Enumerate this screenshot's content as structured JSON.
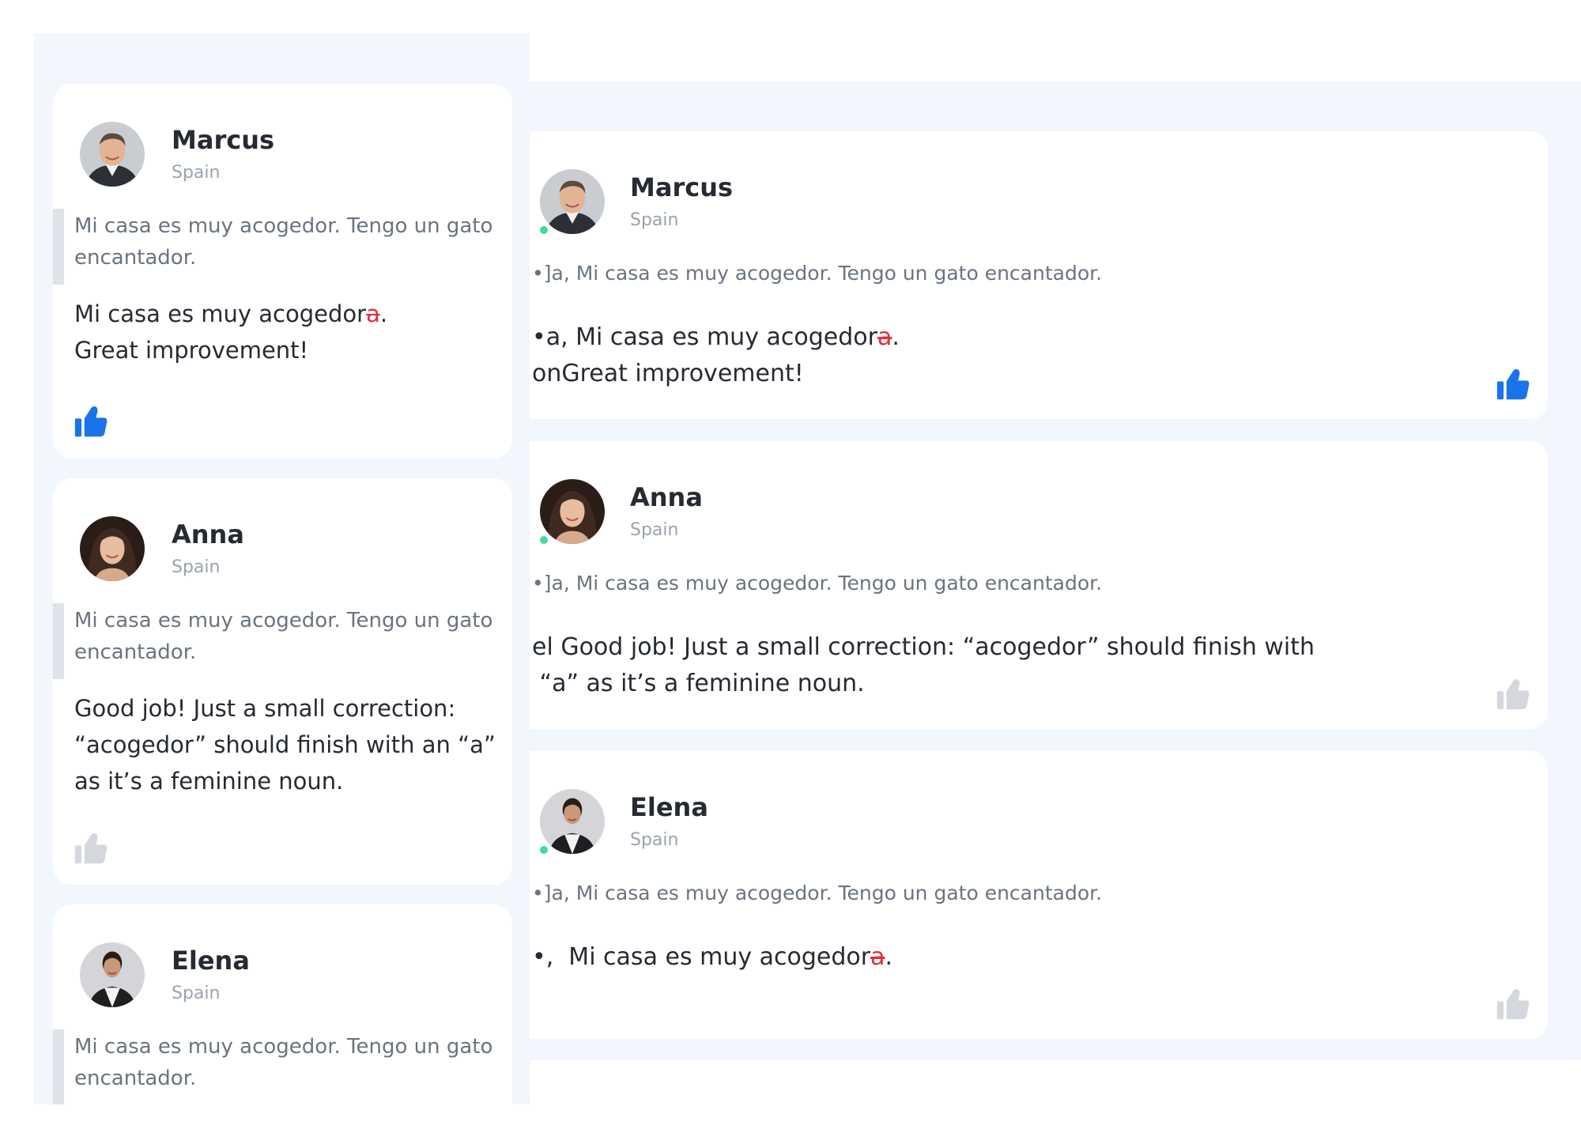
{
  "colors": {
    "panel_bg": "#f2f6fd",
    "card_bg": "#ffffff",
    "name": "#262a33",
    "muted": "#9aa3ae",
    "quote": "#6a7480",
    "correction_strike": "#e0303a",
    "like_active": "#1a73e8",
    "like_inactive": "#d4d8de",
    "online_dot": "#3fdc9c"
  },
  "wide_view": {
    "comments": [
      {
        "name": "Marcus",
        "country": "Spain",
        "quote": "•]a, Mi casa es muy acogedor. Tengo un gato encantador.",
        "reply_line1_prefix": "•a, Mi casa es muy acogedor",
        "reply_line1_struck": "a",
        "reply_line1_suffix": ".",
        "reply_line2": "onGreat improvement!",
        "liked": true,
        "avatar_icon": "avatar-marcus-icon",
        "like_icon": "thumbs-up-icon"
      },
      {
        "name": "Anna",
        "country": "Spain",
        "quote": "•]a, Mi casa es muy acogedor. Tengo un gato encantador.",
        "reply_line1": "el Good job! Just a small correction: “acogedor” should finish with",
        "reply_line2": " “a” as it’s a feminine noun.",
        "liked": false,
        "avatar_icon": "avatar-anna-icon",
        "like_icon": "thumbs-up-icon"
      },
      {
        "name": "Elena",
        "country": "Spain",
        "quote": "•]a, Mi casa es muy acogedor. Tengo un gato encantador.",
        "reply_line1_prefix": "•,  Mi casa es muy acogedor",
        "reply_line1_struck": "a",
        "reply_line1_suffix": ".",
        "liked": false,
        "avatar_icon": "avatar-elena-icon",
        "like_icon": "thumbs-up-icon"
      }
    ]
  },
  "narrow_view": {
    "comments": [
      {
        "name": "Marcus",
        "country": "Spain",
        "quote": "Mi casa es muy acogedor. Tengo un gato encantador.",
        "reply_line1_prefix": "Mi casa es muy acogedor",
        "reply_line1_struck": "a",
        "reply_line1_suffix": ".",
        "reply_line2": "Great improvement!",
        "liked": true,
        "avatar_icon": "avatar-marcus-icon",
        "like_icon": "thumbs-up-icon"
      },
      {
        "name": "Anna",
        "country": "Spain",
        "quote": "Mi casa es muy acogedor. Tengo un gato encantador.",
        "reply": "Good job! Just a small correction: “acogedor” should finish with an “a” as it’s a feminine noun.",
        "liked": false,
        "avatar_icon": "avatar-anna-icon",
        "like_icon": "thumbs-up-icon"
      },
      {
        "name": "Elena",
        "country": "Spain",
        "quote": "Mi casa es muy acogedor. Tengo un gato encantador.",
        "avatar_icon": "avatar-elena-icon"
      }
    ]
  }
}
